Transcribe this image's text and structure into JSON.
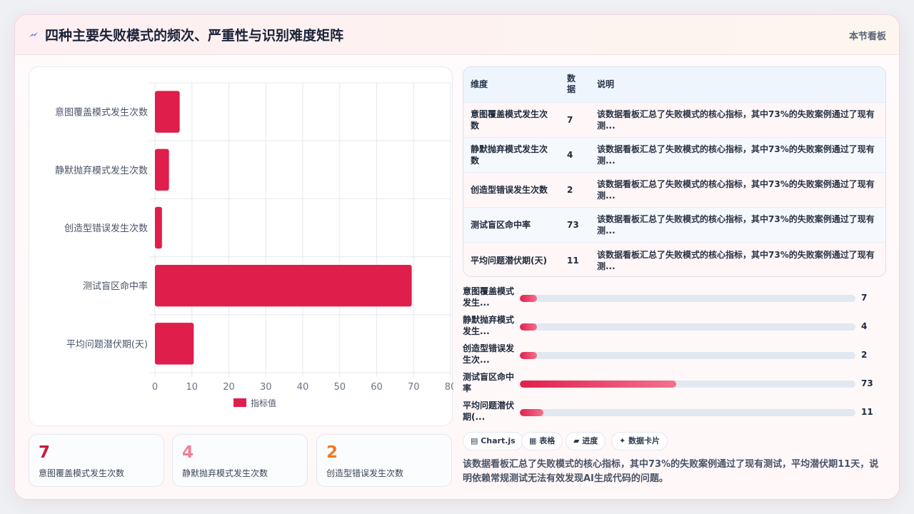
{
  "header": {
    "title": "四种主要失败模式的频次、严重性与识别难度矩阵",
    "right_label": "本节看板",
    "icon": "sparkle-icon"
  },
  "chart_data": {
    "type": "bar",
    "orientation": "horizontal",
    "categories": [
      "意图覆盖模式发生次数",
      "静默抛弃模式发生次数",
      "创造型错误发生次数",
      "测试盲区命中率",
      "平均问题潜伏期(天)"
    ],
    "series": [
      {
        "name": "指标值",
        "values": [
          7,
          4,
          2,
          73,
          11
        ]
      }
    ],
    "xlim": [
      0,
      80
    ],
    "x_ticks": [
      0,
      10,
      20,
      30,
      40,
      50,
      60,
      70,
      80
    ],
    "bar_values_drawn": [
      6.7,
      3.8,
      1.9,
      69.5,
      10.5
    ],
    "grid": true,
    "legend": "bottom",
    "color": "#e01e4b"
  },
  "kpis": [
    {
      "value": "7",
      "label": "意图覆盖模式发生次数",
      "color": "#c8183f"
    },
    {
      "value": "4",
      "label": "静默抛弃模式发生次数",
      "color": "#f08096"
    },
    {
      "value": "2",
      "label": "创造型错误发生次数",
      "color": "#f07a1c"
    }
  ],
  "table": {
    "headers": [
      "维度",
      "数据",
      "说明"
    ],
    "rows": [
      {
        "dim": "意图覆盖模式发生次数",
        "val": "7",
        "desc": "该数据看板汇总了失败模式的核心指标，其中73%的失败案例通过了现有测..."
      },
      {
        "dim": "静默抛弃模式发生次数",
        "val": "4",
        "desc": "该数据看板汇总了失败模式的核心指标，其中73%的失败案例通过了现有测..."
      },
      {
        "dim": "创造型错误发生次数",
        "val": "2",
        "desc": "该数据看板汇总了失败模式的核心指标，其中73%的失败案例通过了现有测..."
      },
      {
        "dim": "测试盲区命中率",
        "val": "73",
        "desc": "该数据看板汇总了失败模式的核心指标，其中73%的失败案例通过了现有测..."
      },
      {
        "dim": "平均问题潜伏期(天)",
        "val": "11",
        "desc": "该数据看板汇总了失败模式的核心指标，其中73%的失败案例通过了现有测..."
      }
    ]
  },
  "progress": [
    {
      "label": "意图覆盖模式发生...",
      "value": "7",
      "fraction": 0.05
    },
    {
      "label": "静默抛弃模式发生...",
      "value": "4",
      "fraction": 0.05
    },
    {
      "label": "创造型错误发生次...",
      "value": "2",
      "fraction": 0.05
    },
    {
      "label": "测试盲区命中率",
      "value": "73",
      "fraction": 0.465
    },
    {
      "label": "平均问题潜伏期(...",
      "value": "11",
      "fraction": 0.07
    }
  ],
  "chips": [
    "▤ Chart.js",
    "▦ 表格",
    "▰ 进度",
    "✦ 数据卡片"
  ],
  "summary": "该数据看板汇总了失败模式的核心指标，其中73%的失败案例通过了现有测试，平均潜伏期11天，说明依赖常规测试无法有效发现AI生成代码的问题。"
}
